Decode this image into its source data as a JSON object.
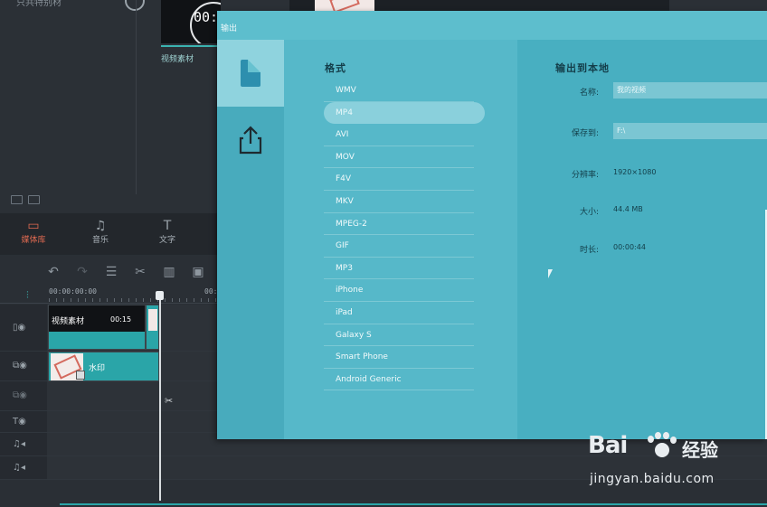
{
  "background": {
    "top_left_text": "只共特别材",
    "media_clock_text": "00:",
    "media_label": "视频素材",
    "tabs": [
      {
        "label": "媒体库",
        "icon": "folder-icon",
        "active": true
      },
      {
        "label": "音乐",
        "icon": "music-note-icon",
        "active": false
      },
      {
        "label": "文字",
        "icon": "text-icon",
        "active": false
      }
    ],
    "toolbar_icons": [
      "undo-icon",
      "redo-icon",
      "adjust-icon",
      "cut-icon",
      "delete-icon",
      "crop-icon"
    ],
    "ruler": {
      "start_time": "00:00:00:00",
      "next_time": "00:"
    },
    "clips": {
      "video_name": "视频素材",
      "video_duration": "00:15",
      "pip_name": "水印"
    }
  },
  "dialog": {
    "title": "输出",
    "format_section_title": "格式",
    "formats": [
      "WMV",
      "MP4",
      "AVI",
      "MOV",
      "F4V",
      "MKV",
      "MPEG-2",
      "GIF",
      "MP3",
      "iPhone",
      "iPad",
      "Galaxy S",
      "Smart Phone",
      "Android Generic"
    ],
    "selected_format": "MP4",
    "details_title": "输出到本地",
    "fields": {
      "name_label": "名称:",
      "name_value": "我的视频",
      "save_label": "保存到:",
      "save_value": "F:\\",
      "resolution_label": "分辨率:",
      "resolution_value": "1920×1080",
      "size_label": "大小:",
      "size_value": "44.4 MB",
      "duration_label": "时长:",
      "duration_value": "00:00:44"
    }
  },
  "watermark": {
    "logo_text": "Bai",
    "cn_text": "经验",
    "url": "jingyan.baidu.com"
  },
  "colors": {
    "accent_orange": "#e06a51",
    "teal_clip": "#2aa5a8",
    "dialog_bg": "#4cb1c3"
  }
}
